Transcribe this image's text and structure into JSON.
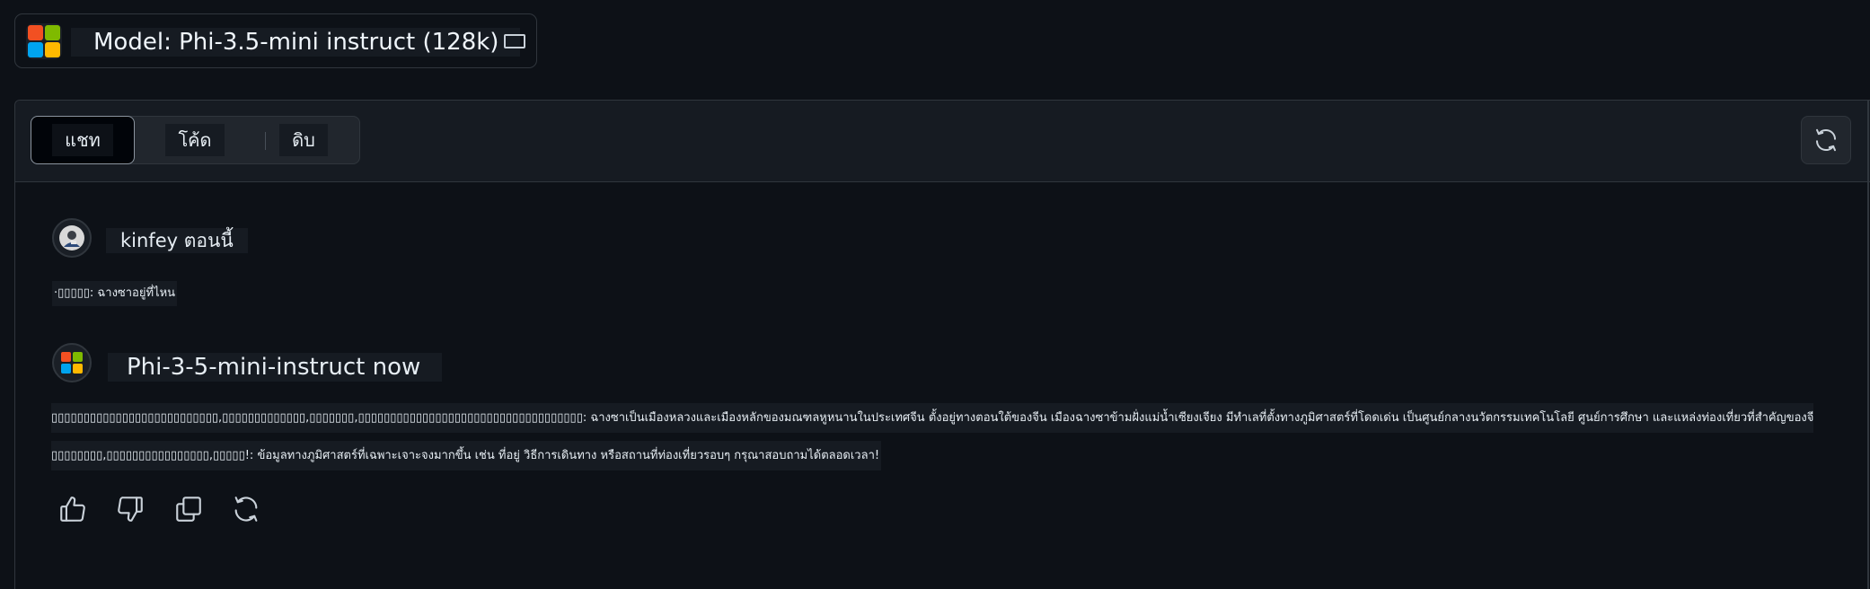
{
  "model": {
    "title": "Model: Phi-3.5-mini instruct (128k)",
    "logo_colors": [
      "#f25022",
      "#7fba00",
      "#00a4ef",
      "#ffb900"
    ]
  },
  "tabs": [
    {
      "label": "แชท"
    },
    {
      "label": "โค้ด"
    },
    {
      "label": "ดิบ"
    }
  ],
  "header": {
    "refresh_icon": "refresh-icon"
  },
  "messages": [
    {
      "author": "kinfey ตอนนี้",
      "text": "·▯▯▯▯▯: ฉางซาอยู่ที่ไหน"
    },
    {
      "author": "Phi-3-5-mini-instruct now",
      "text_line1": "▯▯▯▯▯▯▯▯▯▯▯▯▯▯▯▯▯▯▯▯▯▯▯▯▯▯,▯▯▯▯▯▯▯▯▯▯▯▯▯,▯▯▯▯▯▯▯,▯▯▯▯▯▯▯▯▯▯▯▯▯▯▯▯▯▯▯▯▯▯▯▯▯▯▯▯▯▯▯▯▯▯▯: ฉางซาเป็นเมืองหลวงและเมืองหลักของมณฑลหูหนานในประเทศจีน ตั้งอยู่ทางตอนใต้ของจีน เมืองฉางซาข้ามฝั่งแม่น้ำเซียงเจียง มีทำเลที่ตั้งทางภูมิศาสตร์ที่โดดเด่น เป็นศูนย์กลางนวัตกรรมเทคโนโลยี ศูนย์การศึกษา และแหล่งท่องเที่ยวที่สำคัญของจีน หากคุณต้องการ",
      "text_line2": "▯▯▯▯▯▯▯▯,▯▯▯▯▯▯▯▯▯▯▯▯▯▯▯▯,▯▯▯▯▯!: ข้อมูลทางภูมิศาสตร์ที่เฉพาะเจาะจงมากขึ้น เช่น ที่อยู่ วิธีการเดินทาง หรือสถานที่ท่องเที่ยวรอบๆ กรุณาสอบถามได้ตลอดเวลา!"
    }
  ],
  "actions": [
    {
      "icon": "thumbs-up-icon"
    },
    {
      "icon": "thumbs-down-icon"
    },
    {
      "icon": "copy-icon"
    },
    {
      "icon": "regenerate-icon"
    }
  ]
}
